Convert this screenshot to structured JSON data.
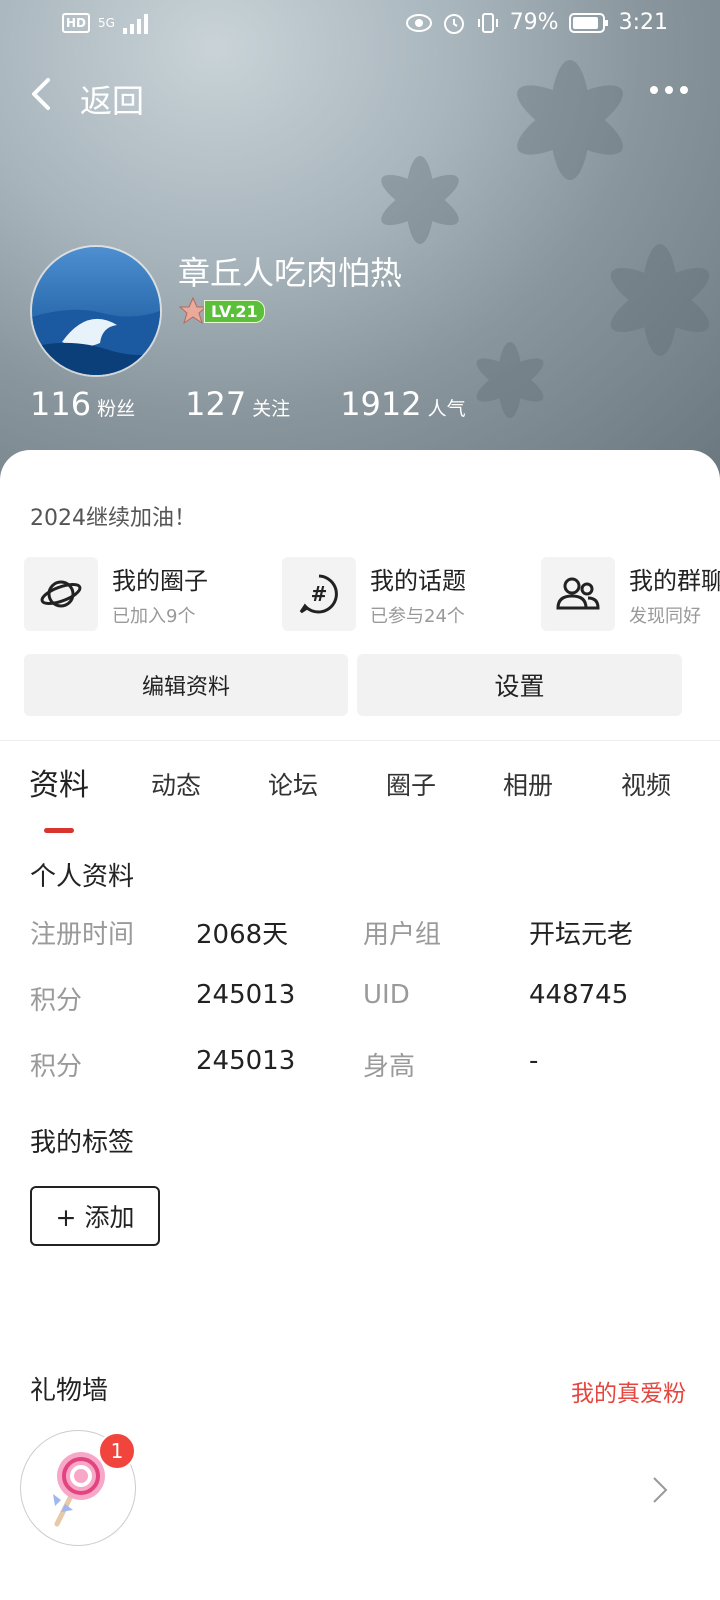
{
  "status_bar": {
    "hd": "HD",
    "network": "5G",
    "battery": "79%",
    "time": "3:21"
  },
  "nav": {
    "back_label": "返回"
  },
  "profile": {
    "username": "章丘人吃肉怕热",
    "level": "LV.21",
    "stats": [
      {
        "value": "116",
        "label": "粉丝"
      },
      {
        "value": "127",
        "label": "关注"
      },
      {
        "value": "1912",
        "label": "人气"
      }
    ],
    "signature": "2024继续加油！"
  },
  "quick_links": [
    {
      "title": "我的圈子",
      "subtitle": "已加入9个",
      "icon": "planet-icon"
    },
    {
      "title": "我的话题",
      "subtitle": "已参与24个",
      "icon": "hashtag-icon"
    },
    {
      "title": "我的群聊",
      "subtitle": "发现同好",
      "icon": "group-icon"
    }
  ],
  "buttons": {
    "edit": "编辑资料",
    "settings": "设置"
  },
  "tabs": [
    "资料",
    "动态",
    "论坛",
    "圈子",
    "相册",
    "视频"
  ],
  "info": {
    "title": "个人资料",
    "rows": [
      {
        "l1": "注册时间",
        "v1": "2068天",
        "l2": "用户组",
        "v2": "开坛元老"
      },
      {
        "l1": "积分",
        "v1": "245013",
        "l2": "UID",
        "v2": "448745"
      },
      {
        "l1": "积分",
        "v1": "245013",
        "l2": "身高",
        "v2": "-"
      }
    ]
  },
  "tags": {
    "title": "我的标签",
    "add_label": "+ 添加"
  },
  "gifts": {
    "title": "礼物墙",
    "link": "我的真爱粉",
    "count": "1"
  },
  "colors": {
    "accent": "#d9352f",
    "link": "#e5463f",
    "level_badge": "#5bbf3a"
  }
}
